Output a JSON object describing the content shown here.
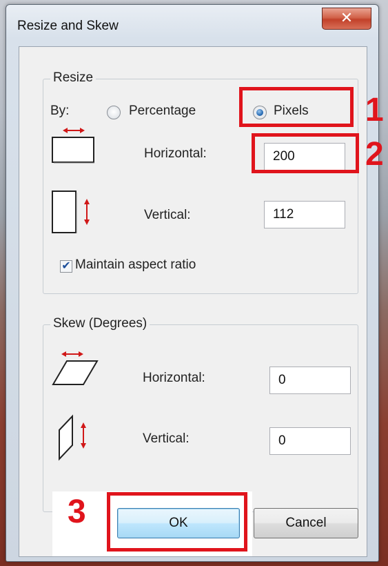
{
  "window": {
    "title": "Resize and Skew",
    "close_glyph": "✕"
  },
  "resize": {
    "group_label": "Resize",
    "by_label": "By:",
    "options": [
      {
        "label": "Percentage",
        "selected": false
      },
      {
        "label": "Pixels",
        "selected": true
      }
    ],
    "horizontal_label": "Horizontal:",
    "horizontal_value": "200",
    "vertical_label": "Vertical:",
    "vertical_value": "112",
    "maintain_aspect_label": "Maintain aspect ratio",
    "maintain_aspect_checked": true
  },
  "skew": {
    "group_label": "Skew (Degrees)",
    "horizontal_label": "Horizontal:",
    "horizontal_value": "0",
    "vertical_label": "Vertical:",
    "vertical_value": "0"
  },
  "buttons": {
    "ok_label": "OK",
    "cancel_label": "Cancel"
  },
  "annotations": {
    "step1": "1",
    "step2": "2",
    "step3": "3",
    "color": "#e0141c"
  },
  "icons": {
    "resize_horizontal": "resize-horizontal-icon",
    "resize_vertical": "resize-vertical-icon",
    "skew_horizontal": "skew-horizontal-icon",
    "skew_vertical": "skew-vertical-icon"
  }
}
